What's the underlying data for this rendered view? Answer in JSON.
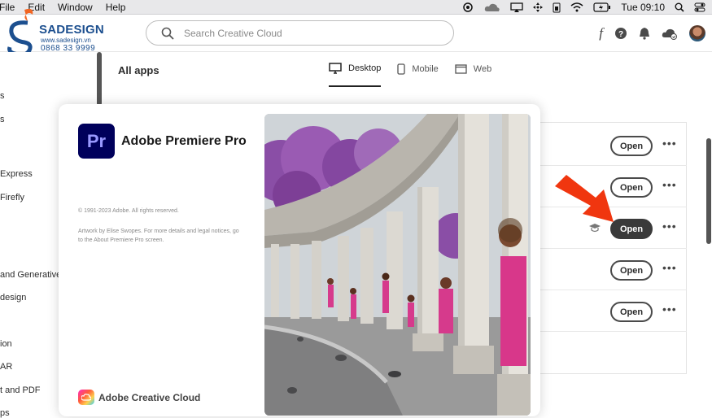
{
  "menubar": {
    "items": [
      "File",
      "Edit",
      "Window",
      "Help"
    ],
    "clock": "Tue 09:10"
  },
  "logo": {
    "brand": "SADESIGN",
    "site": "www.sadesign.vn",
    "phone": "0868 33 9999"
  },
  "search": {
    "placeholder": "Search Creative Cloud"
  },
  "header_icons": [
    "fonts-icon",
    "help-icon",
    "notifications-icon",
    "cloud-sync-icon",
    "avatar"
  ],
  "header": {
    "fonts_glyph": "f"
  },
  "sidebar": {
    "items": [
      "s",
      "s",
      "Express",
      "Firefly",
      "and Generative A",
      "design",
      "ion",
      "AR",
      "t and PDF",
      "ps"
    ]
  },
  "main": {
    "title": "All apps",
    "tabs": [
      {
        "label": "Desktop",
        "icon": "desktop-icon",
        "active": true
      },
      {
        "label": "Mobile",
        "icon": "mobile-icon",
        "active": false
      },
      {
        "label": "Web",
        "icon": "web-icon",
        "active": false
      }
    ]
  },
  "app_list": {
    "rows": [
      {
        "open_label": "Open",
        "primary": false,
        "learn_icon": false
      },
      {
        "open_label": "Open",
        "primary": false,
        "learn_icon": false
      },
      {
        "open_label": "Open",
        "primary": true,
        "learn_icon": true
      },
      {
        "open_label": "Open",
        "primary": false,
        "learn_icon": false
      },
      {
        "open_label": "Open",
        "primary": false,
        "learn_icon": false
      }
    ],
    "more_label": "•••"
  },
  "splash": {
    "app_abbr": "Pr",
    "app_name": "Adobe Premiere Pro",
    "copyright": "© 1991-2023 Adobe. All rights reserved.",
    "artwork": "Artwork by Elise Swopes. For more details and legal notices, go to the About Premiere Pro screen.",
    "cc_label": "Adobe Creative Cloud"
  },
  "colors": {
    "premiere_bg": "#00005b",
    "premiere_fg": "#9999ff",
    "arrow": "#f0360f",
    "brand": "#1c4f8f"
  }
}
